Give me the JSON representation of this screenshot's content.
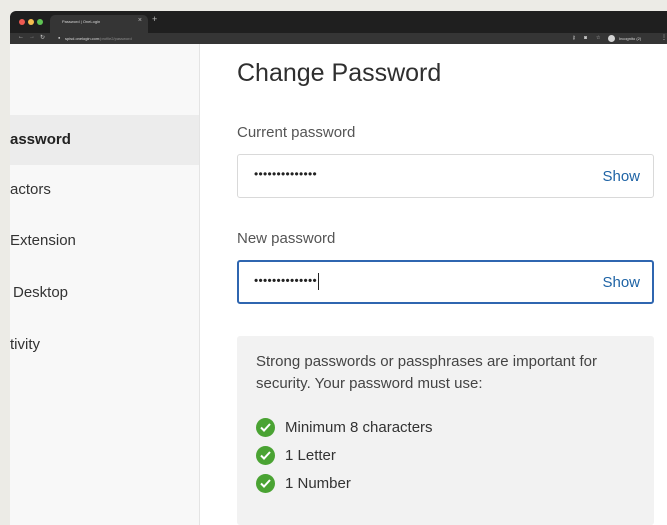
{
  "browser": {
    "tab_title": "Password | OneLogin",
    "tab_close": "×",
    "new_tab": "+",
    "url_host": "spisd.onelogin.com",
    "url_path": "/profile2/password",
    "incognito_label": "Incognito (2)"
  },
  "sidebar": {
    "items": [
      {
        "label": "assword",
        "active": true
      },
      {
        "label": "actors",
        "active": false
      },
      {
        "label": "Extension",
        "active": false
      },
      {
        "label": "Desktop",
        "active": false
      },
      {
        "label": "tivity",
        "active": false
      }
    ]
  },
  "main": {
    "title": "Change Password",
    "current_password": {
      "label": "Current password",
      "value": "••••••••••••••",
      "show_label": "Show"
    },
    "new_password": {
      "label": "New password",
      "value": "••••••••••••••",
      "show_label": "Show"
    },
    "requirements": {
      "intro": "Strong passwords or passphrases are important for security. Your password must use:",
      "items": [
        {
          "label": "Minimum 8 characters",
          "met": true
        },
        {
          "label": "1 Letter",
          "met": true
        },
        {
          "label": "1 Number",
          "met": true
        }
      ]
    }
  },
  "colors": {
    "accent": "#1e63a5",
    "focus_border": "#2f66b0",
    "check_green": "#4aa333"
  }
}
